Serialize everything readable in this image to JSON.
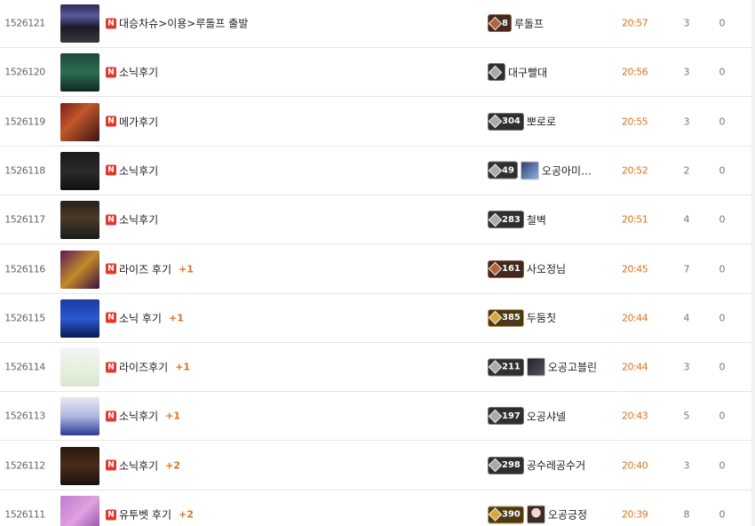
{
  "posts": [
    {
      "number": "1526121",
      "title": "대승차슈>이용>루돌프 출발",
      "comments": "",
      "level": "8",
      "author": "루돌프",
      "time": "20:57",
      "views": "3",
      "likes": "0",
      "thumb": "linear-gradient(180deg,#2b2b5a 0%,#5a5a9a 30%,#1a1a2a 60%,#3a3a3a 100%)",
      "badge": "bronze",
      "avatar": false
    },
    {
      "number": "1526120",
      "title": "소닉후기",
      "comments": "",
      "level": "",
      "author": "대구빨대",
      "time": "20:56",
      "views": "3",
      "likes": "0",
      "thumb": "linear-gradient(180deg,#1d4a3a 0%,#2c6b4e 50%,#0f2a22 100%)",
      "badge": "silver",
      "avatar": false
    },
    {
      "number": "1526119",
      "title": "메가후기",
      "comments": "",
      "level": "304",
      "author": "뽀로로",
      "time": "20:55",
      "views": "3",
      "likes": "0",
      "thumb": "linear-gradient(135deg,#7a1d1d 0%,#c2572a 40%,#3b1414 100%)",
      "badge": "silver",
      "avatar": false
    },
    {
      "number": "1526118",
      "title": "소닉후기",
      "comments": "",
      "level": "49",
      "author": "오공아미…",
      "time": "20:52",
      "views": "2",
      "likes": "0",
      "thumb": "linear-gradient(180deg,#1a1a1a 0%,#2a2a2a 50%,#111 100%)",
      "badge": "silver",
      "avatar": true,
      "avatar_style": "blue"
    },
    {
      "number": "1526117",
      "title": "소닉후기",
      "comments": "",
      "level": "283",
      "author": "철벽",
      "time": "20:51",
      "views": "4",
      "likes": "0",
      "thumb": "linear-gradient(180deg,#2a2018 0%,#4a3a28 45%,#1a1a1a 100%)",
      "badge": "silver",
      "avatar": false
    },
    {
      "number": "1526116",
      "title": "라이즈 후기",
      "comments": "+1",
      "level": "161",
      "author": "사오정님",
      "time": "20:45",
      "views": "7",
      "likes": "0",
      "thumb": "linear-gradient(135deg,#5a1a5a 0%,#c28a2a 50%,#3a1040 100%)",
      "badge": "bronze",
      "avatar": false
    },
    {
      "number": "1526115",
      "title": "소닉 후기",
      "comments": "+1",
      "level": "385",
      "author": "두둠칫",
      "time": "20:44",
      "views": "4",
      "likes": "0",
      "thumb": "linear-gradient(180deg,#1a3aa0 0%,#2a5ad0 50%,#0a1a50 100%)",
      "badge": "gold",
      "avatar": false
    },
    {
      "number": "1526114",
      "title": "라이즈후기",
      "comments": "+1",
      "level": "211",
      "author": "오공고블린",
      "time": "20:44",
      "views": "3",
      "likes": "0",
      "thumb": "linear-gradient(180deg,#f4f4f4 0%,#e8f0e0 50%,#d8e8d0 100%)",
      "badge": "silver",
      "avatar": true,
      "avatar_style": "dark"
    },
    {
      "number": "1526113",
      "title": "소닉후기",
      "comments": "+1",
      "level": "197",
      "author": "오공샤넬",
      "time": "20:43",
      "views": "5",
      "likes": "0",
      "thumb": "linear-gradient(180deg,#e8e8f0 0%,#b0b8e0 50%,#2a3a9a 100%)",
      "badge": "silver",
      "avatar": false
    },
    {
      "number": "1526112",
      "title": "소닉후기",
      "comments": "+2",
      "level": "298",
      "author": "공수레공수거",
      "time": "20:40",
      "views": "3",
      "likes": "0",
      "thumb": "linear-gradient(180deg,#2a1a10 0%,#4a2a18 50%,#1a1010 100%)",
      "badge": "silver",
      "avatar": false
    },
    {
      "number": "1526111",
      "title": "유투벳 후기",
      "comments": "+2",
      "level": "390",
      "author": "오공긍정",
      "time": "20:39",
      "views": "8",
      "likes": "0",
      "thumb": "linear-gradient(135deg,#c07ad0 0%,#e0a0e0 50%,#8a4aa0 100%)",
      "badge": "gold",
      "avatar": true,
      "avatar_style": "girl"
    }
  ]
}
